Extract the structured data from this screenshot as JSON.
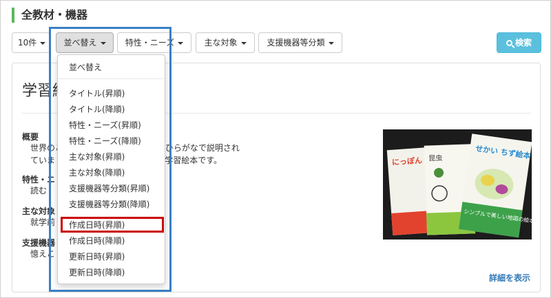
{
  "page": {
    "title": "全教材・機器"
  },
  "toolbar": {
    "count_label": "10件",
    "sort_label": "並べ替え",
    "trait_label": "特性・ニーズ",
    "target_label": "主な対象",
    "category_label": "支援機器等分類",
    "search_label": "検索"
  },
  "item": {
    "title": "学習絵本",
    "overview_label": "概要",
    "overview_line1": "世界のこと などがわかりやすい絵とひらがなで説明され",
    "overview_line2": "ていま やすいように工夫されている学習絵本です。",
    "trait_label": "特性・ニ",
    "trait_value": "読む",
    "target_label": "主な対象",
    "target_value": "就学前",
    "category_label": "支援機器",
    "category_value": "憶えこ",
    "detail_link": "詳細を表示",
    "photo_books": [
      "にっぽん ちず絵本",
      "昆虫",
      "せかい ちず絵本"
    ],
    "photo_caption": "シンプルで美しい地図の絵本"
  },
  "sort_menu": {
    "header": "並べ替え",
    "items": [
      "タイトル(昇順)",
      "タイトル(降順)",
      "特性・ニーズ(昇順)",
      "特性・ニーズ(降順)",
      "主な対象(昇順)",
      "主な対象(降順)",
      "支援機器等分類(昇順)",
      "支援機器等分類(降順)",
      "作成日時(昇順)",
      "作成日時(降順)",
      "更新日時(昇順)",
      "更新日時(降順)"
    ]
  },
  "colors": {
    "accent_green": "#5cb85c",
    "search_button": "#5bc0de",
    "link_blue": "#337ab7",
    "highlight_blue": "#3a7fc4",
    "highlight_red": "#cc0000"
  }
}
